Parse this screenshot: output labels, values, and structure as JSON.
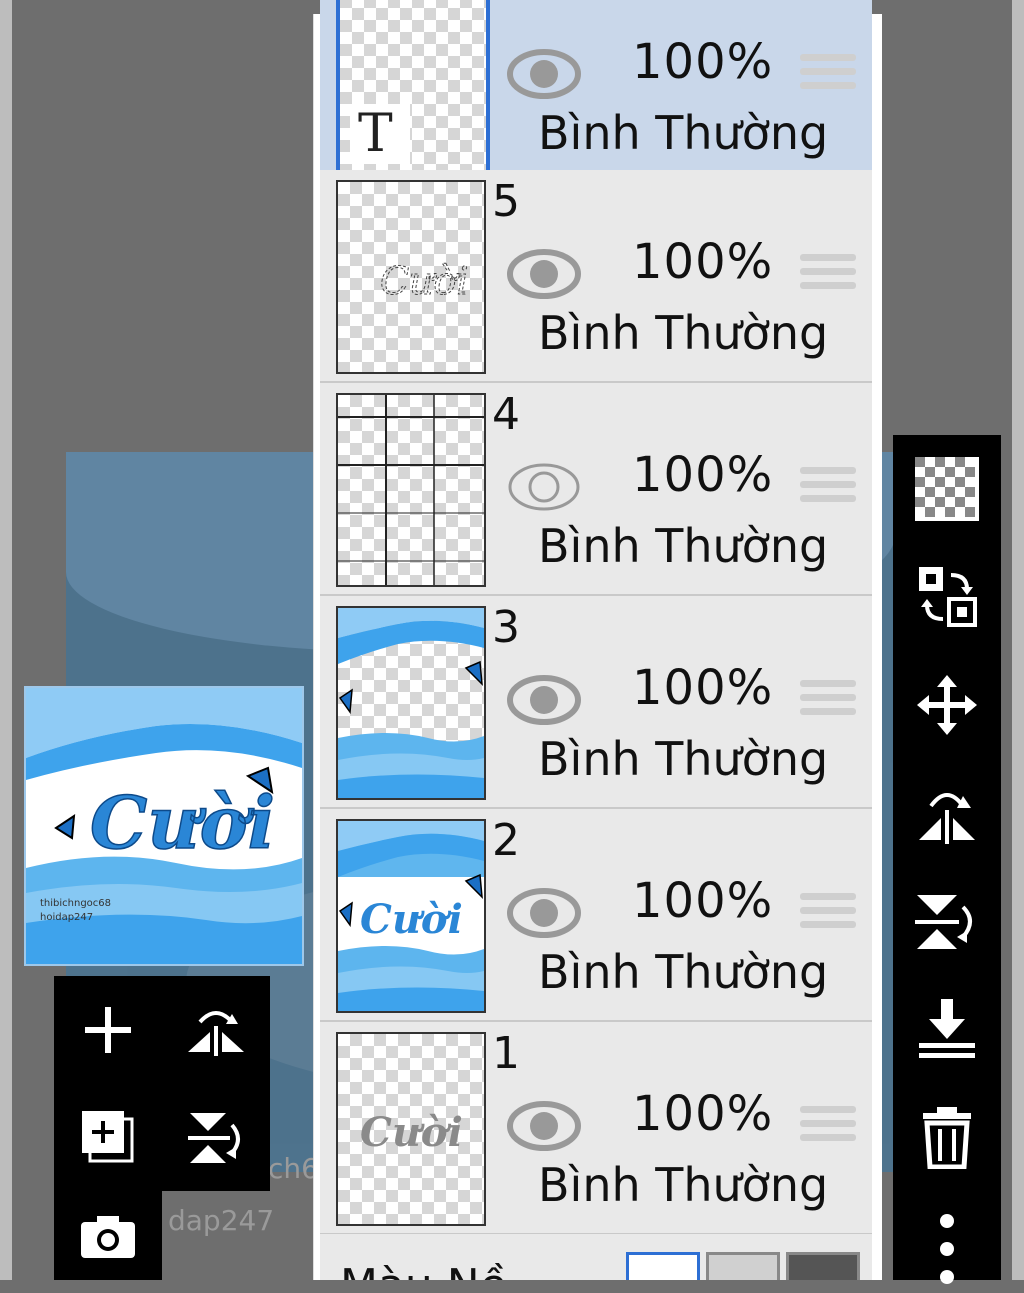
{
  "background_text": {
    "frag1": "ch6",
    "frag2": "dap247"
  },
  "preview": {
    "title_text": "Cười",
    "credit_line1": "thibichngoc68",
    "credit_line2": "hoidap247"
  },
  "layers": [
    {
      "number": "",
      "opacity": "100%",
      "blend": "Bình Thường",
      "visible": true,
      "selected": true,
      "thumb_label": "T"
    },
    {
      "number": "5",
      "opacity": "100%",
      "blend": "Bình Thường",
      "visible": true,
      "selected": false
    },
    {
      "number": "4",
      "opacity": "100%",
      "blend": "Bình Thường",
      "visible": false,
      "selected": false
    },
    {
      "number": "3",
      "opacity": "100%",
      "blend": "Bình Thường",
      "visible": true,
      "selected": false
    },
    {
      "number": "2",
      "opacity": "100%",
      "blend": "Bình Thường",
      "visible": true,
      "selected": false
    },
    {
      "number": "1",
      "opacity": "100%",
      "blend": "Bình Thường",
      "visible": true,
      "selected": false
    }
  ],
  "layer2_thumb_text": "Cười",
  "layer1_thumb_text": "Cười",
  "layer5_thumb_text": "Cười",
  "bottom_strip": {
    "label": "Màu Nề"
  },
  "colors": {
    "selected_row": "#c9d7ea",
    "accent": "#2d6fd4",
    "sky": "#5fb6ee",
    "toolbar": "#000000"
  },
  "icons": {
    "left_toolbar": [
      "add-layer-icon",
      "flip-horizontal-icon",
      "add-layer-copy-icon",
      "flip-vertical-icon",
      "camera-icon"
    ],
    "right_toolbar": [
      "transparency-icon",
      "swap-layer-icon",
      "move-icon",
      "flip-horizontal-icon",
      "flip-vertical-icon",
      "merge-down-icon",
      "trash-icon",
      "more-icon"
    ]
  }
}
